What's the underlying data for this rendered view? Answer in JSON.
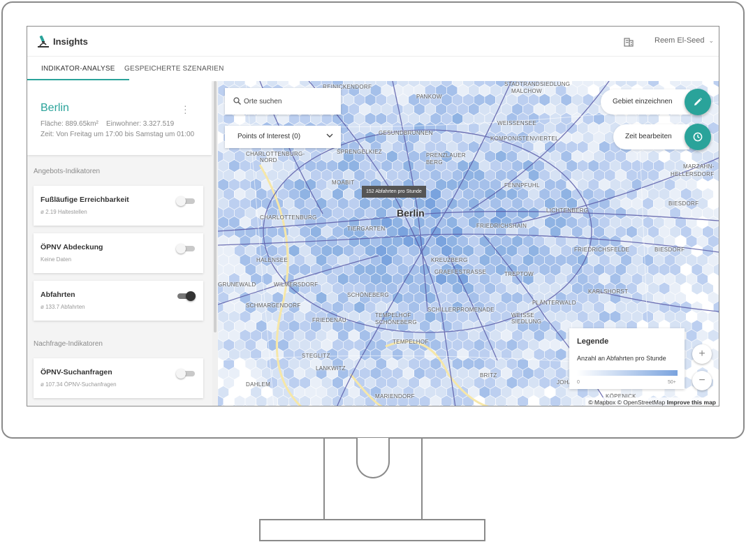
{
  "app": {
    "title": "Insights",
    "user_name": "Reem El-Seed"
  },
  "tabs": [
    {
      "label": "INDIKATOR-ANALYSE",
      "active": true
    },
    {
      "label": "GESPEICHERTE SZENARIEN",
      "active": false
    }
  ],
  "region": {
    "name": "Berlin",
    "area": "Fläche: 889.65km²",
    "population": "Einwohner: 3.327.519",
    "time": "Zeit: Von Freitag um 17:00 bis Samstag um 01:00"
  },
  "sections": {
    "supply": "Angebots-Indikatoren",
    "demand": "Nachfrage-Indikatoren"
  },
  "indicators": [
    {
      "title": "Fußläufige Erreichbarkeit",
      "subtitle": "ø 2.19 Haltestellen",
      "enabled": false
    },
    {
      "title": "ÖPNV Abdeckung",
      "subtitle": "Keine Daten",
      "enabled": false
    },
    {
      "title": "Abfahrten",
      "subtitle": "ø 133.7 Abfahrten",
      "enabled": true
    },
    {
      "title": "ÖPNV-Suchanfragen",
      "subtitle": "ø 107.34 ÖPNV-Suchanfragen",
      "enabled": false
    }
  ],
  "map": {
    "search_placeholder": "Orte suchen",
    "poi_label": "Points of Interest (0)",
    "city_label": "Berlin",
    "tooltip": "152 Abfahrten pro Stunde",
    "draw_area_label": "Gebiet einzeichnen",
    "edit_time_label": "Zeit bearbeiten",
    "legend": {
      "title": "Legende",
      "subtitle": "Anzahl an Abfahrten pro Stunde",
      "min": "0",
      "max": "50+"
    },
    "zoom_in": "+",
    "zoom_out": "−",
    "attribution": "© Mapbox © OpenStreetMap",
    "improve": "Improve this map",
    "districts": [
      "STADTRANDSIEDLUNG",
      "MALCHOW",
      "REINICKENDORF",
      "PANKOW",
      "WEISSENSEE",
      "GESUNDBRUNNEN",
      "KOMPONISTENVIERTEL",
      "PRENZLAUER",
      "BERG",
      "CHARLOTTENBURG-",
      "NORD",
      "SPRENGELKIEZ",
      "MOABIT",
      "FENNPFUHL",
      "MARZAHN-",
      "HELLERSDORF",
      "BIESDORF",
      "CHARLOTTENBURG",
      "TIERGARTEN",
      "FRIEDRICHSHAIN",
      "LICHTENBERG",
      "FRIEDRICHSFELDE",
      "BIESDORF",
      "HALENSEE",
      "KREUZBERG",
      "GRUNEWALD",
      "WILMERSDORF",
      "SCHÖNEBERG",
      "TREPTOW",
      "PLÄNTERWALD",
      "SCHMARGENDORF",
      "FRIEDENAU",
      "TEMPELHOF",
      "SCHÖNEBERG",
      "SCHILLERPROMENADE",
      "WEISSE",
      "SIEDLUNG",
      "KARLSHORST",
      "STEGLITZ",
      "LANKWITZ",
      "MARIENDORF",
      "BRITZ",
      "JOHANNISTHAL",
      "DAHLEM",
      "TEMPELHOF",
      "KÖPENICK",
      "PASTUR",
      "GRAEFESTRASSE"
    ]
  },
  "colors": {
    "accent": "#2aa39a",
    "hex_fill": "#8fb3e3",
    "road_line": "#5a5ca8"
  }
}
